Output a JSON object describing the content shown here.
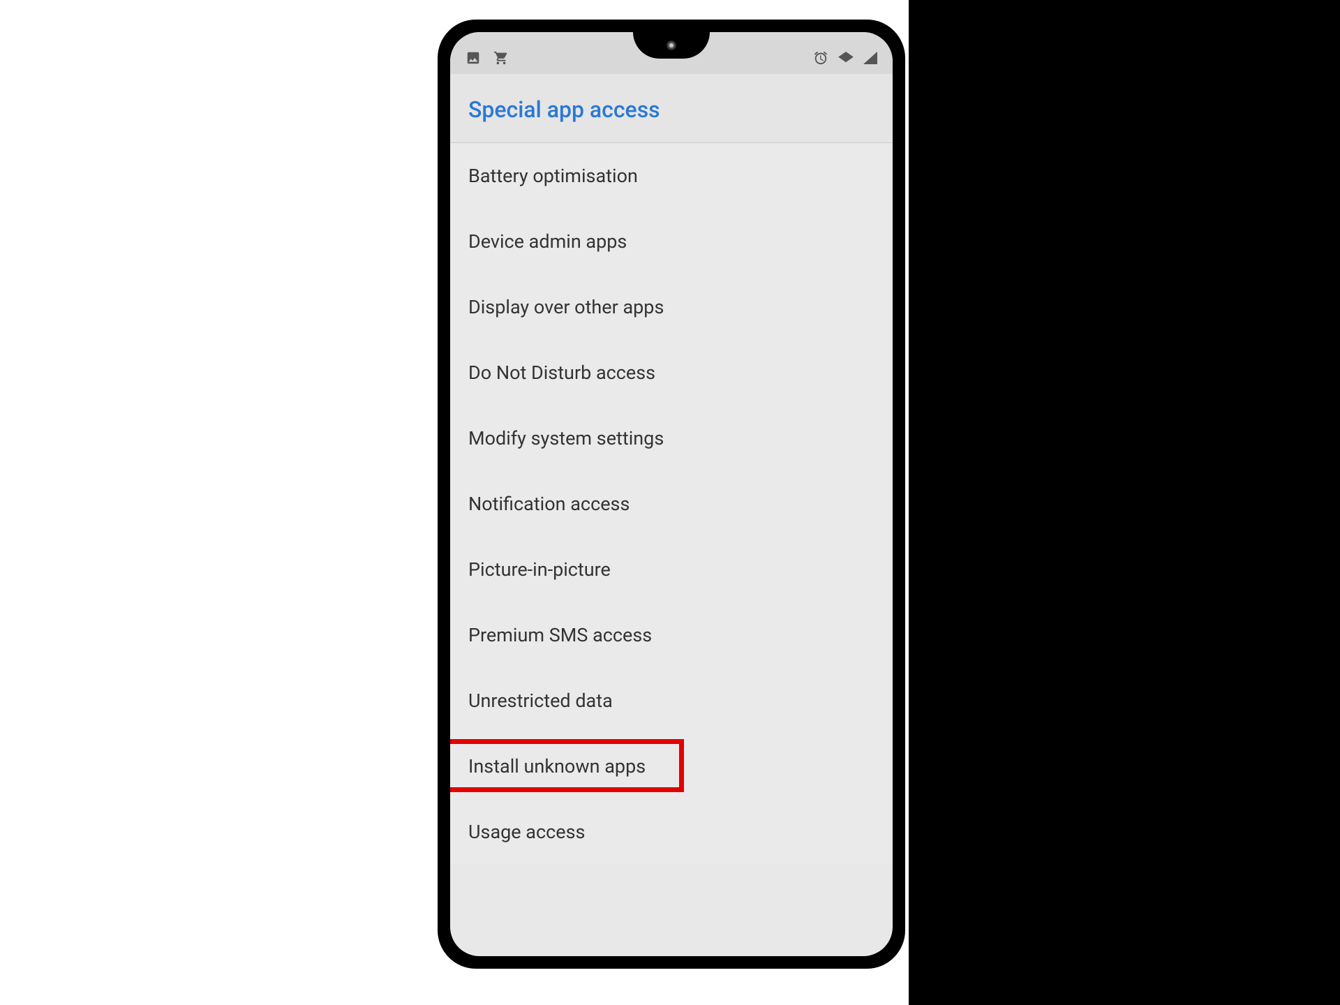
{
  "header": {
    "title": "Special app access"
  },
  "settings": {
    "items": [
      {
        "label": "Battery optimisation",
        "highlighted": false
      },
      {
        "label": "Device admin apps",
        "highlighted": false
      },
      {
        "label": "Display over other apps",
        "highlighted": false
      },
      {
        "label": "Do Not Disturb access",
        "highlighted": false
      },
      {
        "label": "Modify system settings",
        "highlighted": false
      },
      {
        "label": "Notification access",
        "highlighted": false
      },
      {
        "label": "Picture-in-picture",
        "highlighted": false
      },
      {
        "label": "Premium SMS access",
        "highlighted": false
      },
      {
        "label": "Unrestricted data",
        "highlighted": false
      },
      {
        "label": "Install unknown apps",
        "highlighted": true
      },
      {
        "label": "Usage access",
        "highlighted": false
      }
    ]
  },
  "colors": {
    "accent": "#2979d4",
    "highlight": "#e30000",
    "screen_bg": "#eaeaea",
    "text": "#333333"
  }
}
